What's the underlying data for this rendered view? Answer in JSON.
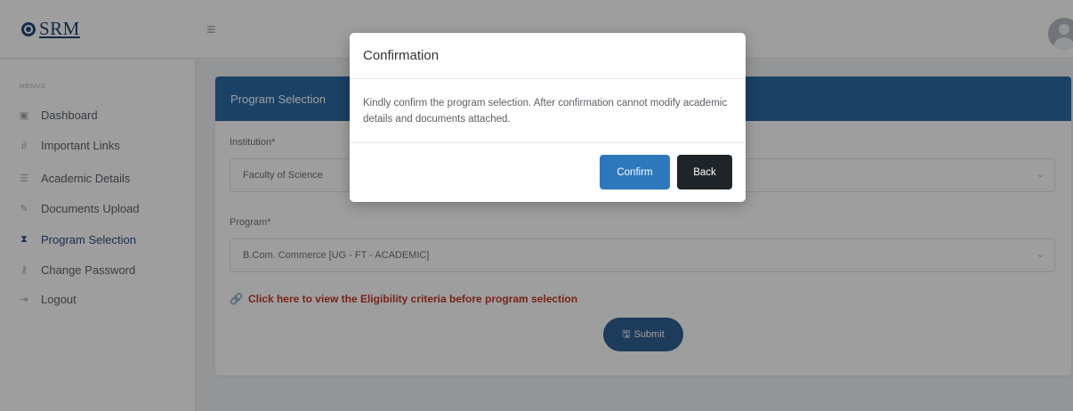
{
  "brand": {
    "logo_text": "SRM"
  },
  "topbar": {
    "menu_icon": "hamburger-icon",
    "avatar_icon": "user-avatar-icon"
  },
  "sidebar": {
    "heading": "MENUS",
    "items": [
      {
        "label": "Dashboard",
        "icon": "dashboard-icon",
        "glyph": "▣",
        "active": false
      },
      {
        "label": "Important Links",
        "icon": "link-icon",
        "glyph": "🔗",
        "active": false
      },
      {
        "label": "Academic Details",
        "icon": "list-icon",
        "glyph": "☰",
        "active": false
      },
      {
        "label": "Documents Upload",
        "icon": "paperclip-icon",
        "glyph": "✎",
        "active": false
      },
      {
        "label": "Program Selection",
        "icon": "hourglass-icon",
        "glyph": "⧗",
        "active": true
      },
      {
        "label": "Change Password",
        "icon": "key-icon",
        "glyph": "⚷",
        "active": false
      },
      {
        "label": "Logout",
        "icon": "logout-icon",
        "glyph": "⇥",
        "active": false
      }
    ]
  },
  "card": {
    "title": "Program Selection",
    "institution_label": "Institution*",
    "institution_value": "Faculty of Science",
    "program_label": "Program*",
    "program_value": "B.Com. Commerce [UG - FT - ACADEMIC]",
    "eligibility_link": "Click here to view the Eligibility criteria before program selection",
    "submit_label": "Submit"
  },
  "modal": {
    "title": "Confirmation",
    "body": "Kindly confirm the program selection. After confirmation cannot modify academic details and documents attached.",
    "confirm_label": "Confirm",
    "back_label": "Back"
  },
  "colors": {
    "brand_blue": "#2a6aa5",
    "confirm_blue": "#2d78bd",
    "back_dark": "#1f2429",
    "link_red": "#c0392b"
  }
}
